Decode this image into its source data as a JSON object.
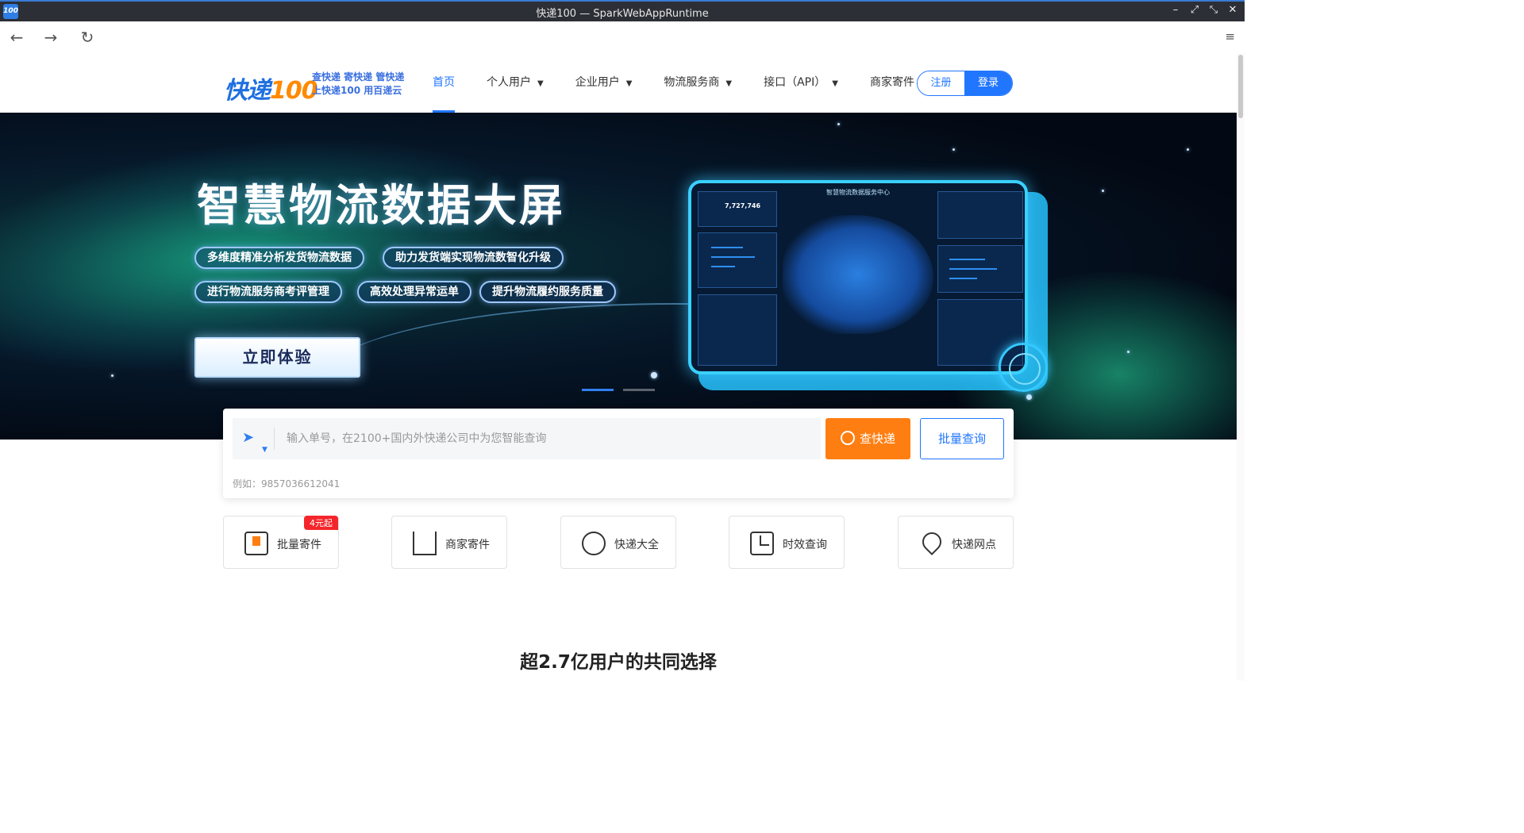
{
  "window": {
    "title": "快递100 — SparkWebAppRuntime",
    "app_icon_text": "100",
    "controls": [
      "minimize-icon",
      "maximize-icon",
      "restore-icon",
      "close-icon"
    ]
  },
  "browser": {
    "back": "←",
    "forward": "→",
    "reload": "↻",
    "menu": "≡"
  },
  "header": {
    "logo_text": "快递",
    "logo_num": "100",
    "slogan_line1": "查快递 寄快递 管快递",
    "slogan_line2": "上快递100  用百递云",
    "nav": [
      {
        "label": "首页",
        "active": true
      },
      {
        "label": "个人用户"
      },
      {
        "label": "企业用户"
      },
      {
        "label": "物流服务商"
      },
      {
        "label": "接口（API）"
      },
      {
        "label": "商家寄件"
      }
    ],
    "register": "注册",
    "login": "登录"
  },
  "banner": {
    "title": "智慧物流数据大屏",
    "features": [
      "多维度精准分析发货物流数据",
      "助力发货端实现物流数智化升级",
      "进行物流服务商考评管理",
      "高效处理异常运单",
      "提升物流履约服务质量"
    ],
    "cta": "立即体验",
    "dashboard_title": "智慧物流数据服务中心",
    "dashboard_value": "7,727,746"
  },
  "search": {
    "placeholder": "输入单号，在2100+国内外快递公司中为您智能查询",
    "value": "",
    "query_button": "查快递",
    "batch_button": "批量查询",
    "example": "例如：9857036612041"
  },
  "services": [
    {
      "label": "批量寄件",
      "icon": "box-icon",
      "badge": "4元起"
    },
    {
      "label": "商家寄件",
      "icon": "building-icon"
    },
    {
      "label": "快递大全",
      "icon": "globe-icon"
    },
    {
      "label": "时效查询",
      "icon": "clock-icon"
    },
    {
      "label": "快递网点",
      "icon": "location-pin-icon"
    }
  ],
  "section_title": "超2.7亿用户的共同选择",
  "colors": {
    "brand_blue": "#2176ff",
    "orange": "#ff7e11",
    "badge_red": "#f5262b"
  }
}
